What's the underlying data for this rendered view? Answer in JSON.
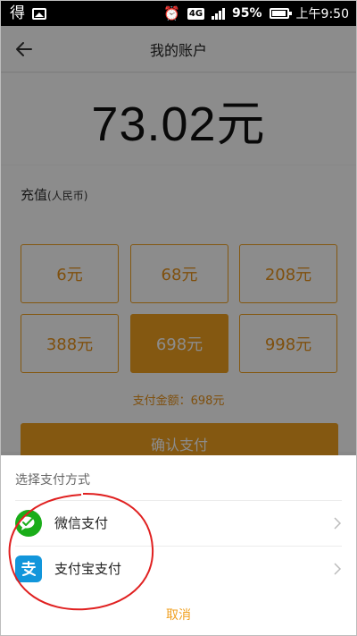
{
  "status_bar": {
    "app_glyph": "得",
    "network": "4G",
    "battery": "95%",
    "time": "上午9:50"
  },
  "header": {
    "title": "我的账户"
  },
  "balance": "73.02元",
  "recharge": {
    "title": "充值",
    "subtitle": "(人民币)",
    "amounts": [
      "6元",
      "68元",
      "208元",
      "388元",
      "698元",
      "998元"
    ],
    "selected": "698元",
    "pay_total": "支付金额：698元",
    "confirm_label": "确认支付"
  },
  "pay_sheet": {
    "title": "选择支付方式",
    "methods": [
      {
        "label": "微信支付",
        "icon": "wechat-pay-icon",
        "color": "#1aad19"
      },
      {
        "label": "支付宝支付",
        "icon": "alipay-icon",
        "color": "#1296db"
      }
    ],
    "cancel_label": "取消"
  },
  "colors": {
    "accent": "#f0a020",
    "annotation": "#e02020"
  }
}
